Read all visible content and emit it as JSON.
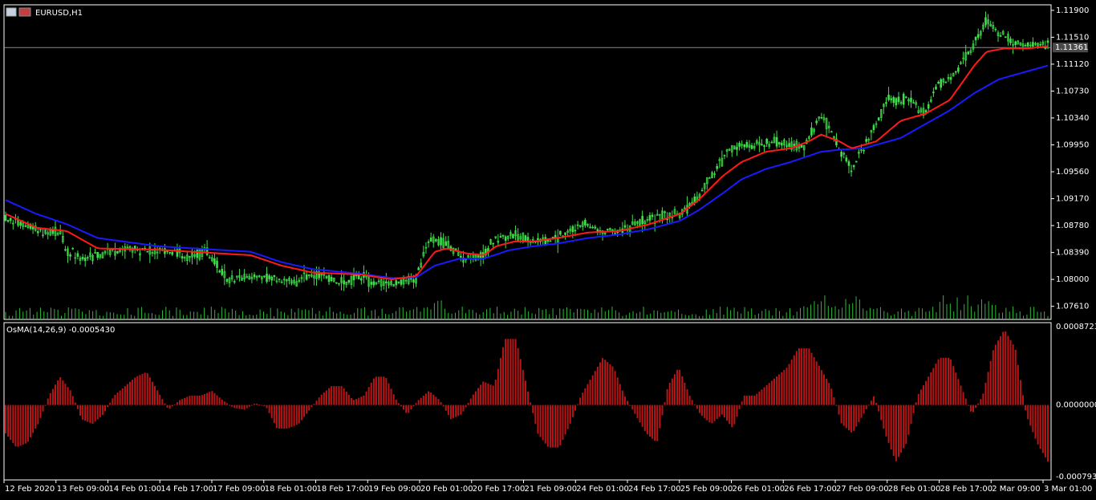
{
  "window": {
    "title": "EURUSD,H1"
  },
  "colors": {
    "background": "#000000",
    "frame": "#ffffff",
    "candle": "#3fe04a",
    "ma_fast": "#ff1a1a",
    "ma_slow": "#1a1aff",
    "volume": "#2fb83a",
    "osma": "#b81616",
    "price_line": "#8a8a8a",
    "current_price_bg": "#4a4a4a",
    "axis_text": "#ffffff"
  },
  "chart_data": [
    {
      "type": "candlestick",
      "title": "EURUSD,H1",
      "x_ticks": [
        "12 Feb 2020",
        "13 Feb 09:00",
        "14 Feb 01:00",
        "14 Feb 17:00",
        "17 Feb 09:00",
        "18 Feb 01:00",
        "18 Feb 17:00",
        "19 Feb 09:00",
        "20 Feb 01:00",
        "20 Feb 17:00",
        "21 Feb 09:00",
        "24 Feb 01:00",
        "24 Feb 17:00",
        "25 Feb 09:00",
        "26 Feb 01:00",
        "26 Feb 17:00",
        "27 Feb 09:00",
        "28 Feb 01:00",
        "28 Feb 17:00",
        "2 Mar 09:00",
        "3 Mar 01:00"
      ],
      "y_ticks": [
        "1.11900",
        "1.11510",
        "1.11120",
        "1.10730",
        "1.10340",
        "1.09950",
        "1.09560",
        "1.09170",
        "1.08780",
        "1.08390",
        "1.08000",
        "1.07610"
      ],
      "ylim": [
        1.0742,
        1.1198
      ],
      "current_price": "1.11361",
      "price_path": [
        [
          0,
          1.089
        ],
        [
          0.06,
          1.087
        ],
        [
          0.09,
          1.0865
        ],
        [
          0.1,
          1.084
        ],
        [
          0.13,
          1.083
        ],
        [
          0.2,
          1.0845
        ],
        [
          0.3,
          1.0835
        ],
        [
          0.33,
          1.084
        ],
        [
          0.36,
          1.08
        ],
        [
          0.42,
          1.0805
        ],
        [
          0.47,
          1.0795
        ],
        [
          0.5,
          1.081
        ],
        [
          0.55,
          1.0795
        ],
        [
          0.58,
          1.0805
        ],
        [
          0.6,
          1.0795
        ],
        [
          0.63,
          1.0795
        ],
        [
          0.67,
          1.08
        ],
        [
          0.69,
          1.086
        ],
        [
          0.71,
          1.0855
        ],
        [
          0.75,
          1.083
        ],
        [
          0.78,
          1.0835
        ],
        [
          0.8,
          1.086
        ],
        [
          0.83,
          1.0865
        ],
        [
          0.86,
          1.0855
        ],
        [
          0.9,
          1.086
        ],
        [
          0.94,
          1.088
        ],
        [
          0.97,
          1.087
        ],
        [
          1.0,
          1.087
        ],
        [
          1.05,
          1.089
        ],
        [
          1.1,
          1.0895
        ],
        [
          1.13,
          1.092
        ],
        [
          1.16,
          1.096
        ],
        [
          1.18,
          1.099
        ],
        [
          1.21,
          1.0995
        ],
        [
          1.24,
          1.1
        ],
        [
          1.26,
          1.1
        ],
        [
          1.3,
          1.099
        ],
        [
          1.33,
          1.104
        ],
        [
          1.36,
          1.099
        ],
        [
          1.38,
          1.096
        ],
        [
          1.41,
          1.101
        ],
        [
          1.44,
          1.106
        ],
        [
          1.47,
          1.106
        ],
        [
          1.5,
          1.104
        ],
        [
          1.52,
          1.108
        ],
        [
          1.55,
          1.11
        ],
        [
          1.58,
          1.114
        ],
        [
          1.6,
          1.1175
        ],
        [
          1.63,
          1.115
        ],
        [
          1.66,
          1.114
        ],
        [
          1.7,
          1.114
        ]
      ],
      "ma_fast_path": [
        [
          0,
          1.0895
        ],
        [
          0.05,
          1.0875
        ],
        [
          0.1,
          1.087
        ],
        [
          0.12,
          1.086
        ],
        [
          0.15,
          1.0845
        ],
        [
          0.25,
          1.0843
        ],
        [
          0.4,
          1.0835
        ],
        [
          0.45,
          1.082
        ],
        [
          0.5,
          1.081
        ],
        [
          0.58,
          1.0807
        ],
        [
          0.63,
          1.08
        ],
        [
          0.67,
          1.0805
        ],
        [
          0.7,
          1.084
        ],
        [
          0.72,
          1.0845
        ],
        [
          0.75,
          1.0838
        ],
        [
          0.78,
          1.0835
        ],
        [
          0.8,
          1.0848
        ],
        [
          0.83,
          1.0855
        ],
        [
          0.86,
          1.0855
        ],
        [
          0.9,
          1.086
        ],
        [
          0.95,
          1.0868
        ],
        [
          1.0,
          1.087
        ],
        [
          1.05,
          1.088
        ],
        [
          1.1,
          1.0895
        ],
        [
          1.13,
          1.0915
        ],
        [
          1.17,
          1.095
        ],
        [
          1.2,
          1.097
        ],
        [
          1.24,
          1.0985
        ],
        [
          1.28,
          1.099
        ],
        [
          1.31,
          1.1
        ],
        [
          1.33,
          1.101
        ],
        [
          1.36,
          1.1
        ],
        [
          1.38,
          1.099
        ],
        [
          1.42,
          1.1
        ],
        [
          1.46,
          1.103
        ],
        [
          1.5,
          1.104
        ],
        [
          1.54,
          1.106
        ],
        [
          1.58,
          1.111
        ],
        [
          1.6,
          1.113
        ],
        [
          1.63,
          1.1135
        ],
        [
          1.67,
          1.1135
        ],
        [
          1.7,
          1.1138
        ]
      ],
      "ma_slow_path": [
        [
          0,
          1.0915
        ],
        [
          0.05,
          1.0895
        ],
        [
          0.1,
          1.088
        ],
        [
          0.15,
          1.086
        ],
        [
          0.25,
          1.0848
        ],
        [
          0.4,
          1.084
        ],
        [
          0.45,
          1.0825
        ],
        [
          0.5,
          1.0815
        ],
        [
          0.58,
          1.0808
        ],
        [
          0.63,
          1.0802
        ],
        [
          0.67,
          1.0803
        ],
        [
          0.7,
          1.082
        ],
        [
          0.74,
          1.083
        ],
        [
          0.78,
          1.083
        ],
        [
          0.82,
          1.0842
        ],
        [
          0.86,
          1.0848
        ],
        [
          0.9,
          1.0852
        ],
        [
          0.95,
          1.086
        ],
        [
          1.0,
          1.0865
        ],
        [
          1.05,
          1.0873
        ],
        [
          1.1,
          1.0885
        ],
        [
          1.13,
          1.09
        ],
        [
          1.17,
          1.0925
        ],
        [
          1.2,
          1.0945
        ],
        [
          1.24,
          1.096
        ],
        [
          1.28,
          1.097
        ],
        [
          1.33,
          1.0985
        ],
        [
          1.36,
          1.0988
        ],
        [
          1.4,
          1.099
        ],
        [
          1.46,
          1.1005
        ],
        [
          1.5,
          1.1025
        ],
        [
          1.54,
          1.1045
        ],
        [
          1.58,
          1.107
        ],
        [
          1.62,
          1.109
        ],
        [
          1.66,
          1.11
        ],
        [
          1.7,
          1.111
        ]
      ]
    },
    {
      "type": "bar",
      "title": "OsMA(14,26,9) -0.0005430",
      "y_ticks": [
        "0.0008723",
        "0.0000000",
        "-0.0007933"
      ],
      "ylim": [
        -0.0007933,
        0.0008723
      ],
      "values": [
        -0.0003,
        -0.00045,
        -0.0004,
        -0.0002,
        0.0001,
        0.0003,
        0.00015,
        -0.00015,
        -0.0002,
        -0.0001,
        0.0001,
        0.0002,
        0.0003,
        0.00035,
        0.00015,
        -5e-05,
        5e-05,
        0.0001,
        0.0001,
        0.00015,
        5e-05,
        -3e-05,
        -5e-05,
        2e-05,
        -2e-05,
        -0.00025,
        -0.00025,
        -0.0002,
        -5e-05,
        0.0001,
        0.0002,
        0.0002,
        5e-05,
        0.0001,
        0.0003,
        0.0003,
        5e-05,
        -0.0001,
        5e-05,
        0.00015,
        5e-05,
        -0.00015,
        -0.0001,
        0.0001,
        0.00025,
        0.0002,
        0.0007,
        0.0007,
        0.0002,
        -0.0003,
        -0.00045,
        -0.00045,
        -0.0002,
        0.0001,
        0.0003,
        0.0005,
        0.0004,
        0.0001,
        -0.0001,
        -0.0003,
        -0.0004,
        0.0002,
        0.0004,
        0.0001,
        -0.0001,
        -0.0002,
        -0.0001,
        -0.00025,
        0.0001,
        0.0001,
        0.0002,
        0.0003,
        0.0004,
        0.0006,
        0.0006,
        0.0004,
        0.0002,
        -0.0002,
        -0.0003,
        -0.0001,
        0.0001,
        -0.0003,
        -0.0006,
        -0.0004,
        0.0001,
        0.0003,
        0.0005,
        0.0005,
        0.0002,
        -0.0001,
        0.0001,
        0.0006,
        0.0008,
        0.0006,
        -0.0001,
        -0.0004,
        -0.0006
      ]
    }
  ]
}
